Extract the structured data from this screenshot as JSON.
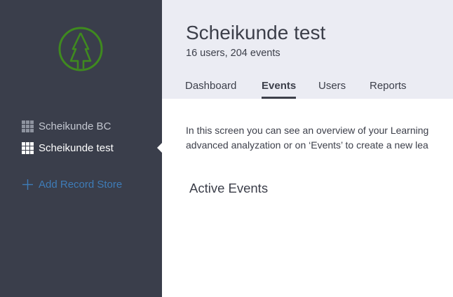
{
  "sidebar": {
    "logo_icon": "tree-circle-logo",
    "logo_color": "#3f8a1f",
    "stores": [
      {
        "label": "Scheikunde BC",
        "icon": "grid-icon",
        "active": false
      },
      {
        "label": "Scheikunde test",
        "icon": "grid-icon",
        "active": true
      }
    ],
    "add_store_label": "Add Record Store",
    "add_store_icon": "plus-icon",
    "colors": {
      "background": "#3a3e4b",
      "link": "#3e7cb8"
    }
  },
  "header": {
    "title": "Scheikunde test",
    "subtitle": "16 users, 204 events",
    "tabs": [
      {
        "label": "Dashboard",
        "active": false
      },
      {
        "label": "Events",
        "active": true
      },
      {
        "label": "Users",
        "active": false
      },
      {
        "label": "Reports",
        "active": false
      }
    ],
    "background": "#ebecf3"
  },
  "main": {
    "intro_line_1": "In this screen you can see an overview of your Learning",
    "intro_line_2": "advanced analyzation or on ‘Events’ to create a new lea",
    "section_title": "Active Events"
  }
}
